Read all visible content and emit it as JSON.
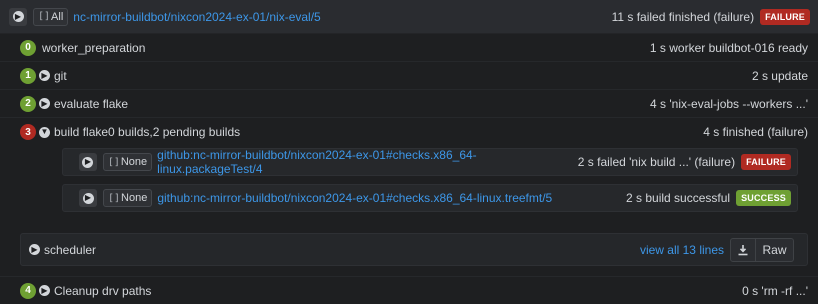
{
  "header": {
    "toggle_label": "All",
    "link": "nc-mirror-buildbot/nixcon2024-ex-01/nix-eval/5",
    "status_text": "11 s failed finished (failure)",
    "badge": "FAILURE"
  },
  "steps": [
    {
      "number": "0",
      "name": "worker_preparation",
      "status": "1 s worker buildbot-016 ready"
    },
    {
      "number": "1",
      "name": "git",
      "status": "2 s update"
    },
    {
      "number": "2",
      "name": "evaluate flake",
      "status": "4 s 'nix-eval-jobs --workers ...'"
    },
    {
      "number": "3",
      "name": "build flake0 builds,2 pending builds",
      "status": "4 s finished (failure)"
    },
    {
      "number": "4",
      "name": "Cleanup drv paths",
      "status": "0 s 'rm -rf ...'"
    }
  ],
  "subbuilds": [
    {
      "toggle_label": "None",
      "link": "github:nc-mirror-buildbot/nixcon2024-ex-01#checks.x86_64-linux.packageTest/4",
      "status": "2 s failed 'nix build ...' (failure)",
      "badge": "FAILURE"
    },
    {
      "toggle_label": "None",
      "link": "github:nc-mirror-buildbot/nixcon2024-ex-01#checks.x86_64-linux.treefmt/5",
      "status": "2 s build successful",
      "badge": "SUCCESS"
    }
  ],
  "scheduler": {
    "label": "scheduler",
    "view_all_link": "view all 13 lines",
    "raw_button": "Raw"
  },
  "icons": {
    "download": "download-icon",
    "chevron": "chevron-right-icon"
  },
  "colors": {
    "success": "#6fa033",
    "failure": "#b02a22",
    "link": "#3d97e8"
  }
}
